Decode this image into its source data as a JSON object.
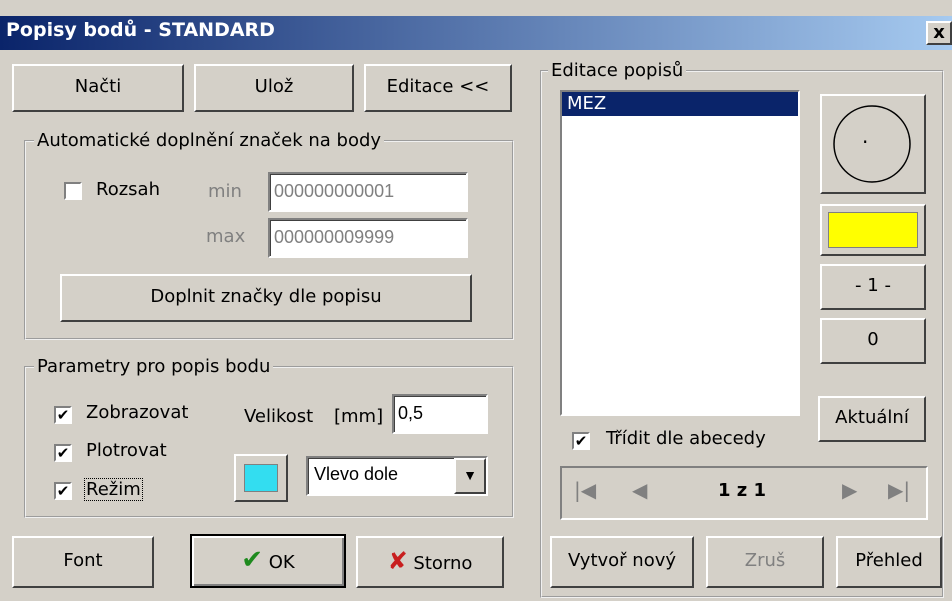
{
  "window": {
    "title": "Popisy bodů - STANDARD",
    "close_label": "x"
  },
  "top_buttons": {
    "nacti": "Načti",
    "uloz": "Ulož",
    "editace": "Editace <<"
  },
  "auto_group": {
    "legend": "Automatické doplnění značek na body",
    "rozsah_label": "Rozsah",
    "rozsah_checked": false,
    "min_label": "min",
    "min_value": "000000000001",
    "max_label": "max",
    "max_value": "000000009999",
    "doplnit_button": "Doplnit značky dle popisu"
  },
  "params_group": {
    "legend": "Parametry pro popis bodu",
    "zobrazovat_label": "Zobrazovat",
    "zobrazovat_checked": true,
    "plotrovat_label": "Plotrovat",
    "plotrovat_checked": true,
    "rezim_label": "Režim",
    "rezim_checked": true,
    "velikost_label": "Velikost",
    "velikost_unit": "[mm]",
    "velikost_value": "0,5",
    "color_swatch": "#33ddf0",
    "position_select": "Vlevo dole"
  },
  "bottom_buttons": {
    "font": "Font",
    "ok": "OK",
    "storno": "Storno"
  },
  "edit_group": {
    "legend": "Editace popisů",
    "items": [
      "MEZ"
    ],
    "selected_index": 0,
    "symbol_label": "·",
    "color_swatch": "#ffff00",
    "line_style_button": "- 1 -",
    "zero_button": "0",
    "aktualni_button": "Aktuální",
    "tridit_label": "Třídit dle abecedy",
    "tridit_checked": true,
    "page_indicator": "1 z 1",
    "vytvor_button": "Vytvoř nový",
    "zrus_button": "Zruš",
    "prehled_button": "Přehled"
  }
}
